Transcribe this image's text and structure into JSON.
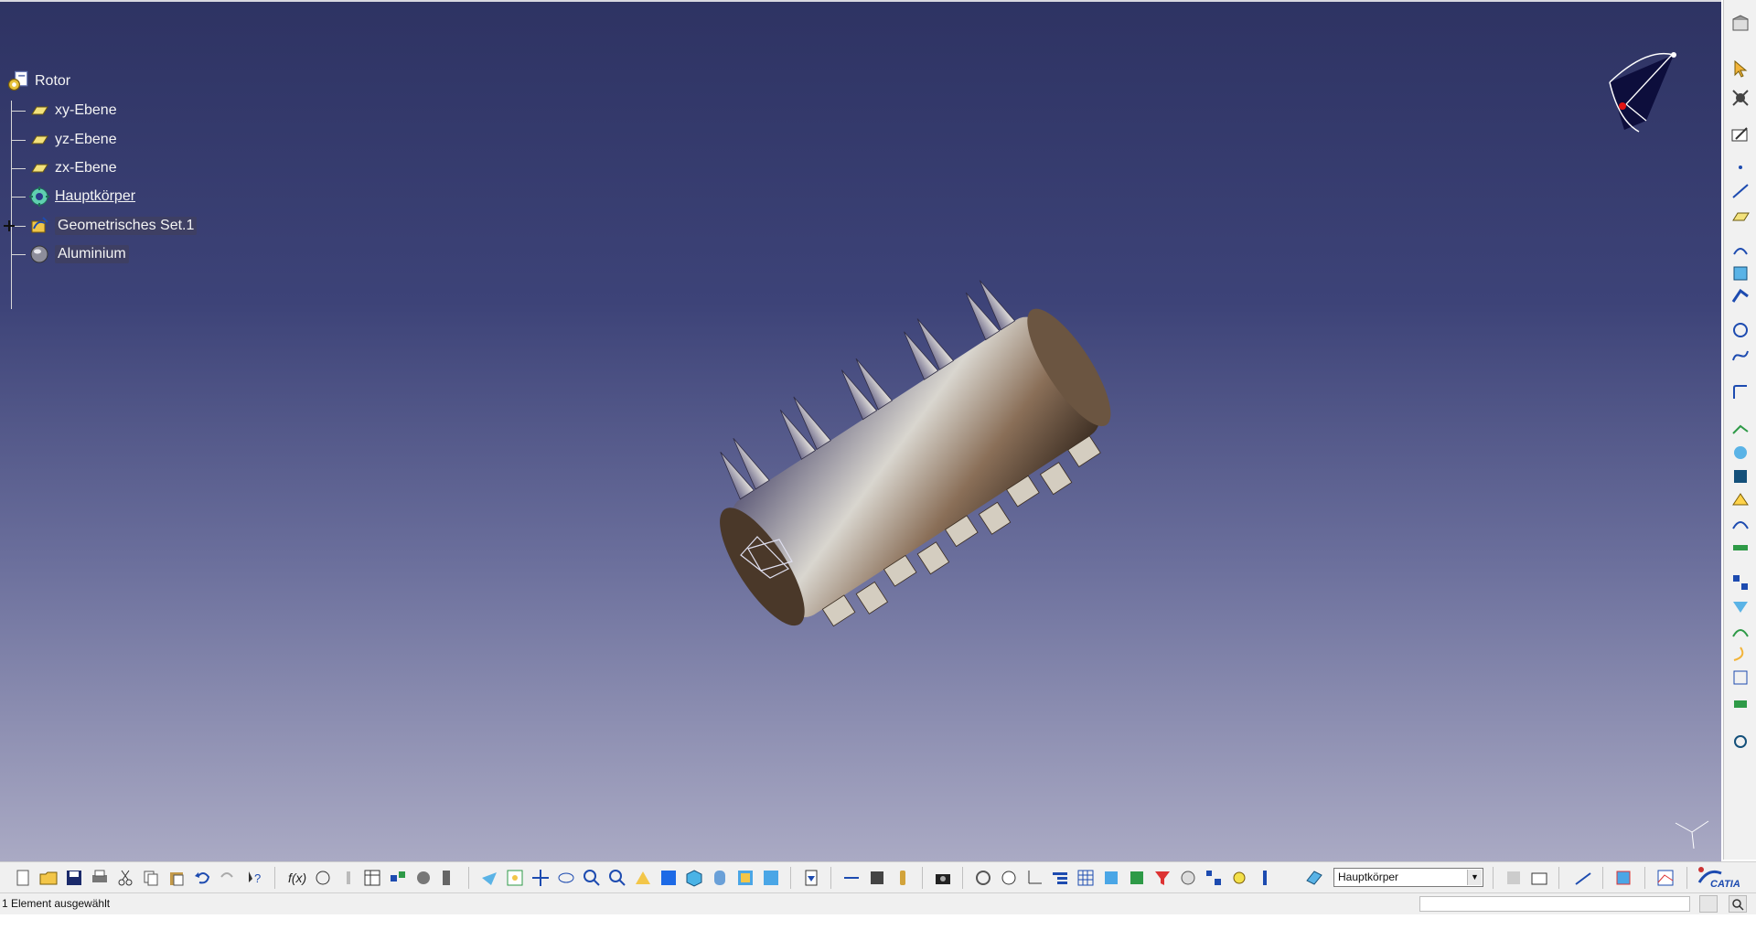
{
  "spec_tree": {
    "root": "Rotor",
    "items": [
      {
        "label": "xy-Ebene",
        "icon": "plane-icon"
      },
      {
        "label": "yz-Ebene",
        "icon": "plane-icon"
      },
      {
        "label": "zx-Ebene",
        "icon": "plane-icon"
      },
      {
        "label": "Hauptkörper",
        "icon": "body-gear-icon"
      },
      {
        "label": "Geometrisches Set.1",
        "icon": "geometrical-set-icon"
      },
      {
        "label": "Aluminium",
        "icon": "material-sphere-icon"
      }
    ]
  },
  "toolbar": {
    "current_body": "Hauptkörper"
  },
  "status": {
    "message": "1 Element ausgewählt",
    "command_input": ""
  },
  "branding": {
    "logo_text": "CATIA"
  },
  "colors": {
    "viewport_top": "#2e3363",
    "viewport_bottom": "#aaaac4",
    "compass": "#0c0c3a"
  }
}
